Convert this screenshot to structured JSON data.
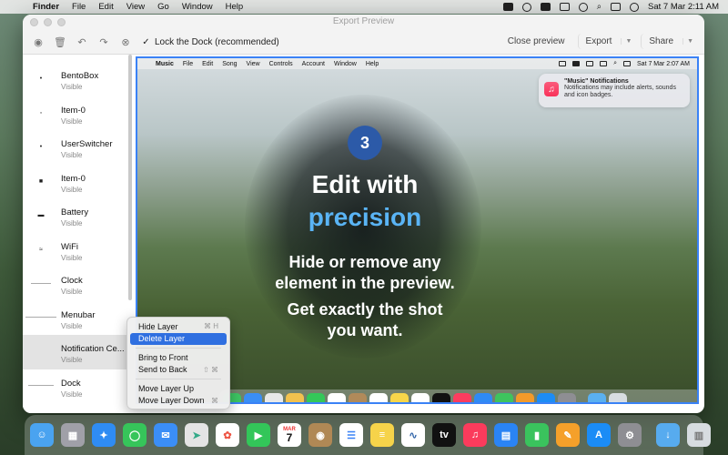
{
  "menubar": {
    "app": "Finder",
    "items": [
      "File",
      "Edit",
      "View",
      "Go",
      "Window",
      "Help"
    ],
    "clock": "Sat 7 Mar  2:11 AM",
    "status_icons": [
      "app-icon",
      "user-icon",
      "keyboard-icon",
      "battery-icon",
      "link-icon",
      "search-icon",
      "control-center-icon",
      "siri-icon"
    ]
  },
  "window": {
    "title": "Export Preview",
    "toolbar": {
      "checkbox_label": "Lock the Dock (recommended)",
      "close_preview": "Close preview",
      "export": "Export",
      "share": "Share"
    }
  },
  "layers": [
    {
      "name": "BentoBox",
      "status": "Visible"
    },
    {
      "name": "Item-0",
      "status": "Visible"
    },
    {
      "name": "UserSwitcher",
      "status": "Visible"
    },
    {
      "name": "Item-0",
      "status": "Visible"
    },
    {
      "name": "Battery",
      "status": "Visible"
    },
    {
      "name": "WiFi",
      "status": "Visible"
    },
    {
      "name": "Clock",
      "status": "Visible"
    },
    {
      "name": "Menubar",
      "status": "Visible"
    },
    {
      "name": "Notification Ce...",
      "status": "Visible"
    },
    {
      "name": "Dock",
      "status": "Visible"
    }
  ],
  "preview": {
    "menubar": {
      "app": "Music",
      "items": [
        "File",
        "Edit",
        "Song",
        "View",
        "Controls",
        "Account",
        "Window",
        "Help"
      ],
      "clock": "Sat 7 Mar  2:07 AM"
    },
    "notification": {
      "title": "\"Music\" Notifications",
      "body": "Notifications may include alerts, sounds and icon badges."
    },
    "step": "3",
    "headline_line1": "Edit with",
    "headline_line2": "precision",
    "sub1_line1": "Hide or remove any",
    "sub1_line2": "element in the preview.",
    "sub2_line1": "Get exactly the shot",
    "sub2_line2": "you want."
  },
  "context_menu": {
    "items": [
      {
        "label": "Hide Layer",
        "shortcut": "⌘ H"
      },
      {
        "label": "Delete Layer",
        "shortcut": ""
      },
      {
        "label": "Bring to Front",
        "shortcut": ""
      },
      {
        "label": "Send to Back",
        "shortcut": "⇧ ⌘"
      },
      {
        "label": "Move Layer Up",
        "shortcut": ""
      },
      {
        "label": "Move Layer Down",
        "shortcut": "⌘"
      }
    ]
  },
  "dock": {
    "calendar_month": "MAR",
    "calendar_day": "7"
  }
}
